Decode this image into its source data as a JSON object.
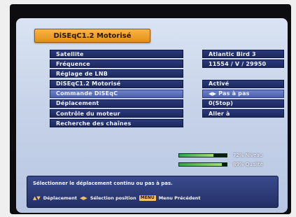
{
  "header": {
    "title": "DiSEqC1.2 Motorisé"
  },
  "menu": {
    "items": [
      {
        "label": "Satellite"
      },
      {
        "label": "Fréquence"
      },
      {
        "label": "Réglage de LNB"
      },
      {
        "label": "DiSEqC1.2 Motorisé"
      },
      {
        "label": "Commande DiSEqC"
      },
      {
        "label": "Déplacement"
      },
      {
        "label": "Contrôle du moteur"
      },
      {
        "label": "Recherche des chaînes"
      }
    ]
  },
  "values": {
    "items": [
      {
        "label": "Atlantic Bird 3"
      },
      {
        "label": "11554 / V / 29950"
      },
      {
        "label": ""
      },
      {
        "label": "Activé"
      },
      {
        "label": "Pas à pas",
        "icon": "left-right-arrows-icon"
      },
      {
        "label": "0(Stop)"
      },
      {
        "label": "Aller à"
      }
    ]
  },
  "signal": {
    "level_label": "72% Niveau",
    "level_percent": 72,
    "quality_label": "89% Qualité",
    "quality_percent": 89,
    "bar_color": "#2ea84e"
  },
  "help": {
    "text": "Sélectionner le déplacement continu ou pas à pas.",
    "hints": {
      "move": "Déplacement",
      "select": "Sélection position",
      "menu_key": "MENU",
      "menu_action": "Menu Précédent"
    }
  },
  "colors": {
    "title_orange": "#e58f14",
    "menu_blue": "#1c275c",
    "selected_blue": "#4b5fae"
  }
}
